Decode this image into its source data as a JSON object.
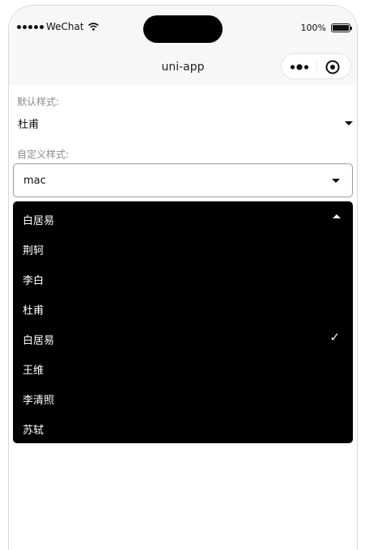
{
  "status_bar": {
    "carrier": "WeChat",
    "battery": "100%"
  },
  "nav": {
    "title": "uni-app"
  },
  "default_section": {
    "label": "默认样式:",
    "selected": "杜甫"
  },
  "custom_section": {
    "label": "自定义样式:",
    "selected": "mac"
  },
  "dropdown": {
    "header": "白居易",
    "options": [
      "荆轲",
      "李白",
      "杜甫",
      "白居易",
      "王维",
      "李清照",
      "苏轼"
    ],
    "checked_index": 3
  }
}
